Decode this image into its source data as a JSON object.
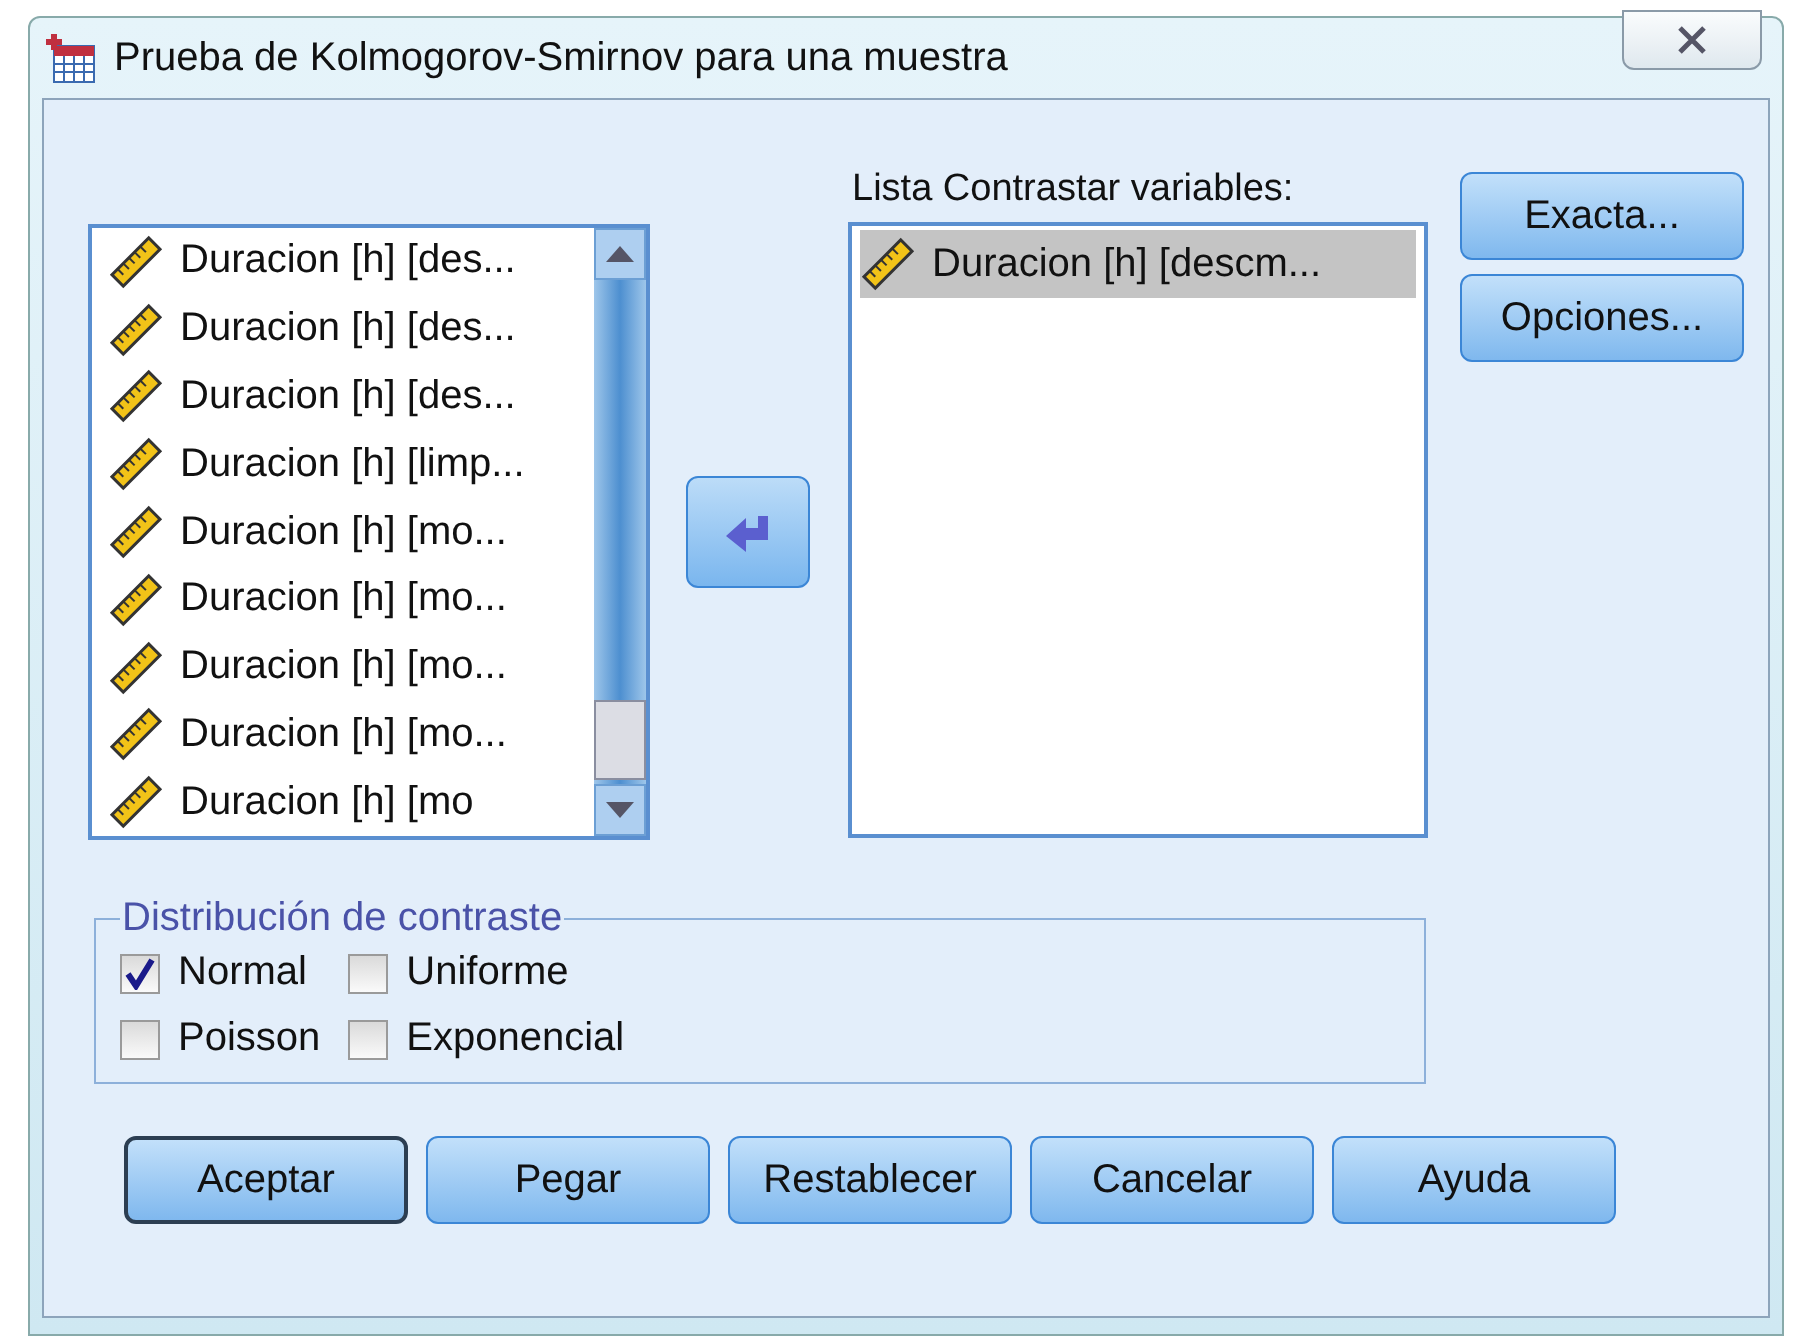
{
  "window": {
    "title": "Prueba de Kolmogorov-Smirnov para una muestra"
  },
  "source_list": {
    "items": [
      {
        "label": "Duracion [h] [des..."
      },
      {
        "label": "Duracion [h] [des..."
      },
      {
        "label": "Duracion [h] [des..."
      },
      {
        "label": "Duracion [h] [limp..."
      },
      {
        "label": "Duracion [h] [mo..."
      },
      {
        "label": "Duracion [h] [mo..."
      },
      {
        "label": "Duracion [h] [mo..."
      },
      {
        "label": "Duracion [h] [mo..."
      },
      {
        "label": "Duracion [h] [mo"
      }
    ]
  },
  "target_list": {
    "label": "Lista Contrastar variables:",
    "items": [
      {
        "label": "Duracion [h] [descm...",
        "selected": true
      }
    ]
  },
  "side_buttons": [
    "Exacta...",
    "Opciones..."
  ],
  "distribution": {
    "title": "Distribución de contraste",
    "options": [
      {
        "label": "Normal",
        "checked": true
      },
      {
        "label": "Uniforme",
        "checked": false
      },
      {
        "label": "Poisson",
        "checked": false
      },
      {
        "label": "Exponencial",
        "checked": false
      }
    ]
  },
  "buttons": [
    {
      "label": "Aceptar",
      "default": true
    },
    {
      "label": "Pegar",
      "default": false
    },
    {
      "label": "Restablecer",
      "default": false
    },
    {
      "label": "Cancelar",
      "default": false
    },
    {
      "label": "Ayuda",
      "default": false
    }
  ]
}
